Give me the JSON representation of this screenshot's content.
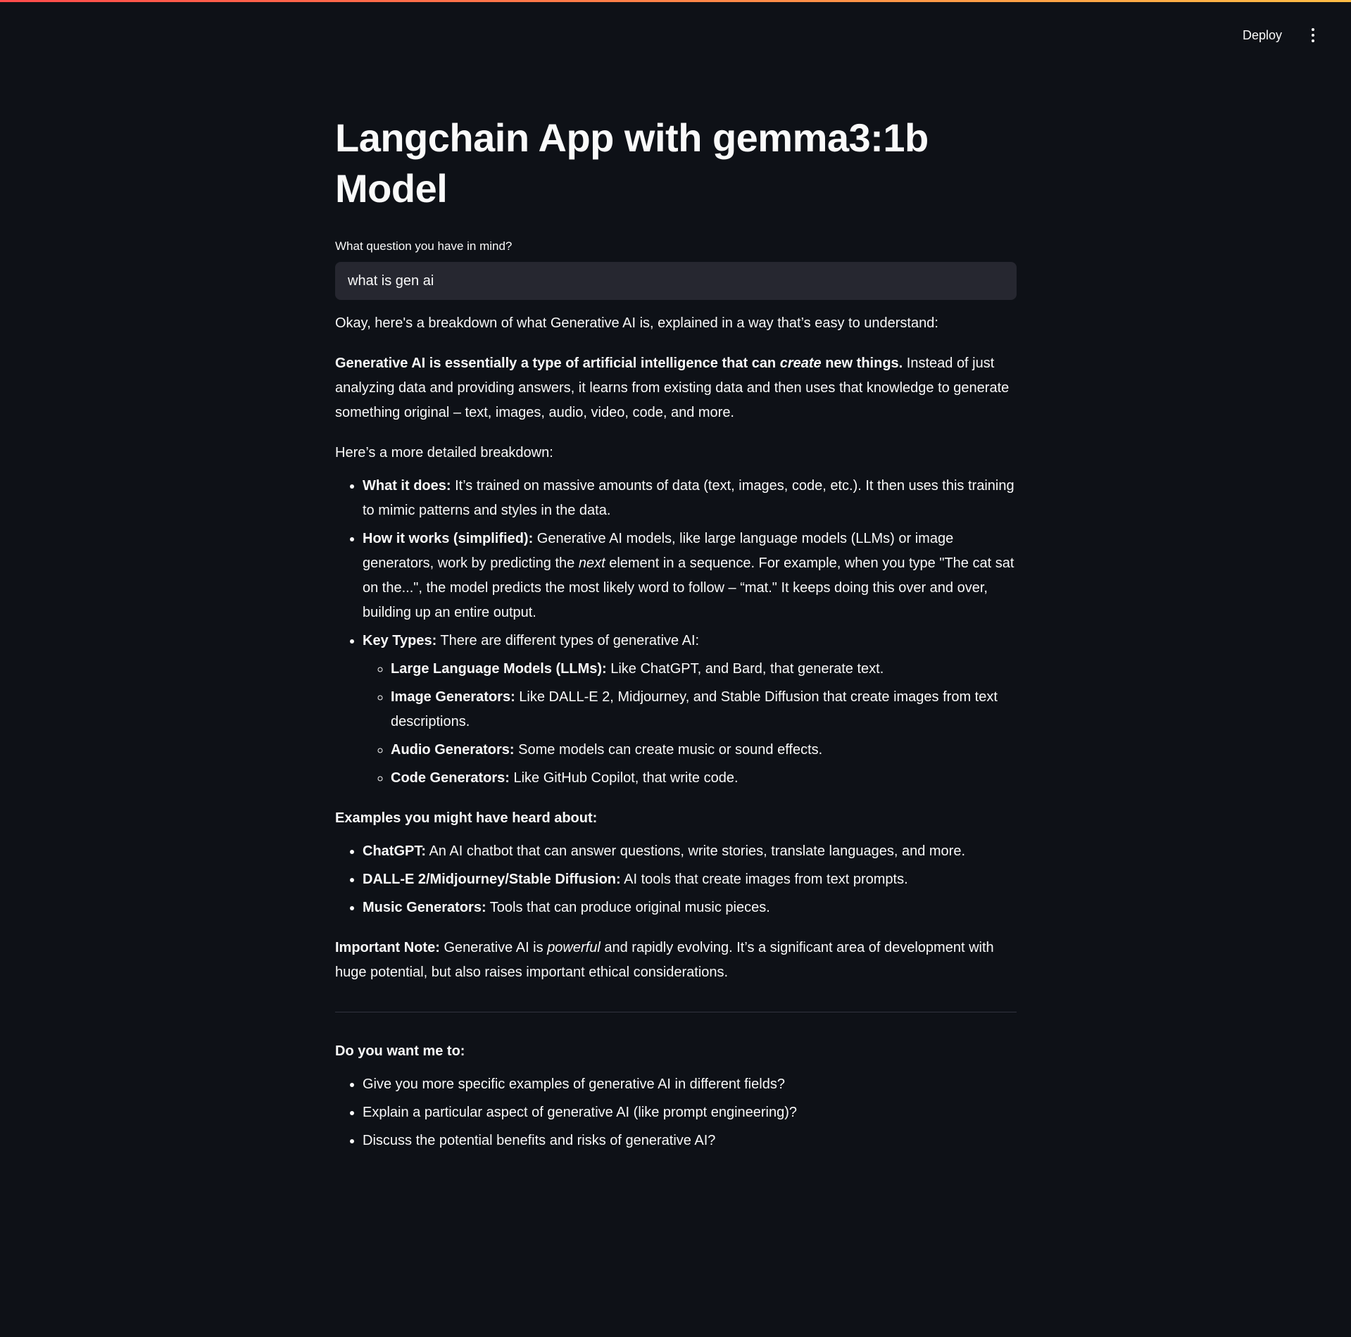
{
  "header": {
    "deploy_label": "Deploy",
    "menu_icon": "kebab-menu-icon"
  },
  "page": {
    "title": "Langchain App with gemma3:1b Model"
  },
  "question": {
    "label": "What question you have in mind?",
    "value": "what is gen ai"
  },
  "answer": {
    "intro": "Okay, here's a breakdown of what Generative AI is, explained in a way that’s easy to understand:",
    "definition": {
      "bold_start": "Generative AI is essentially a type of artificial intelligence that can ",
      "bold_italic": "create",
      "bold_end": " new things.",
      "rest": " Instead of just analyzing data and providing answers, it learns from existing data and then uses that knowledge to generate something original – text, images, audio, video, code, and more."
    },
    "breakdown_intro": "Here’s a more detailed breakdown:",
    "what_it_does": {
      "term": "What it does:",
      "text": " It’s trained on massive amounts of data (text, images, code, etc.). It then uses this training to mimic patterns and styles in the data."
    },
    "how_it_works": {
      "term": "How it works (simplified):",
      "text_before": " Generative AI models, like large language models (LLMs) or image generators, work by predicting the ",
      "italic": "next",
      "text_after": " element in a sequence. For example, when you type \"The cat sat on the...\", the model predicts the most likely word to follow – “mat.\" It keeps doing this over and over, building up an entire output."
    },
    "key_types": {
      "term": "Key Types:",
      "text": " There are different types of generative AI:",
      "items": [
        {
          "term": "Large Language Models (LLMs):",
          "text": " Like ChatGPT, and Bard, that generate text."
        },
        {
          "term": "Image Generators:",
          "text": " Like DALL-E 2, Midjourney, and Stable Diffusion that create images from text descriptions."
        },
        {
          "term": "Audio Generators:",
          "text": " Some models can create music or sound effects."
        },
        {
          "term": "Code Generators:",
          "text": " Like GitHub Copilot, that write code."
        }
      ]
    },
    "examples_heading": "Examples you might have heard about:",
    "examples": [
      {
        "term": "ChatGPT:",
        "text": " An AI chatbot that can answer questions, write stories, translate languages, and more."
      },
      {
        "term": "DALL-E 2/Midjourney/Stable Diffusion:",
        "text": " AI tools that create images from text prompts."
      },
      {
        "term": "Music Generators:",
        "text": " Tools that can produce original music pieces."
      }
    ],
    "note": {
      "term": "Important Note:",
      "text_before": " Generative AI is ",
      "italic": "powerful",
      "text_after": " and rapidly evolving. It’s a significant area of development with huge potential, but also raises important ethical considerations."
    },
    "followup_heading": "Do you want me to:",
    "followups": [
      "Give you more specific examples of generative AI in different fields?",
      "Explain a particular aspect of generative AI (like prompt engineering)?",
      "Discuss the potential benefits and risks of generative AI?"
    ]
  }
}
